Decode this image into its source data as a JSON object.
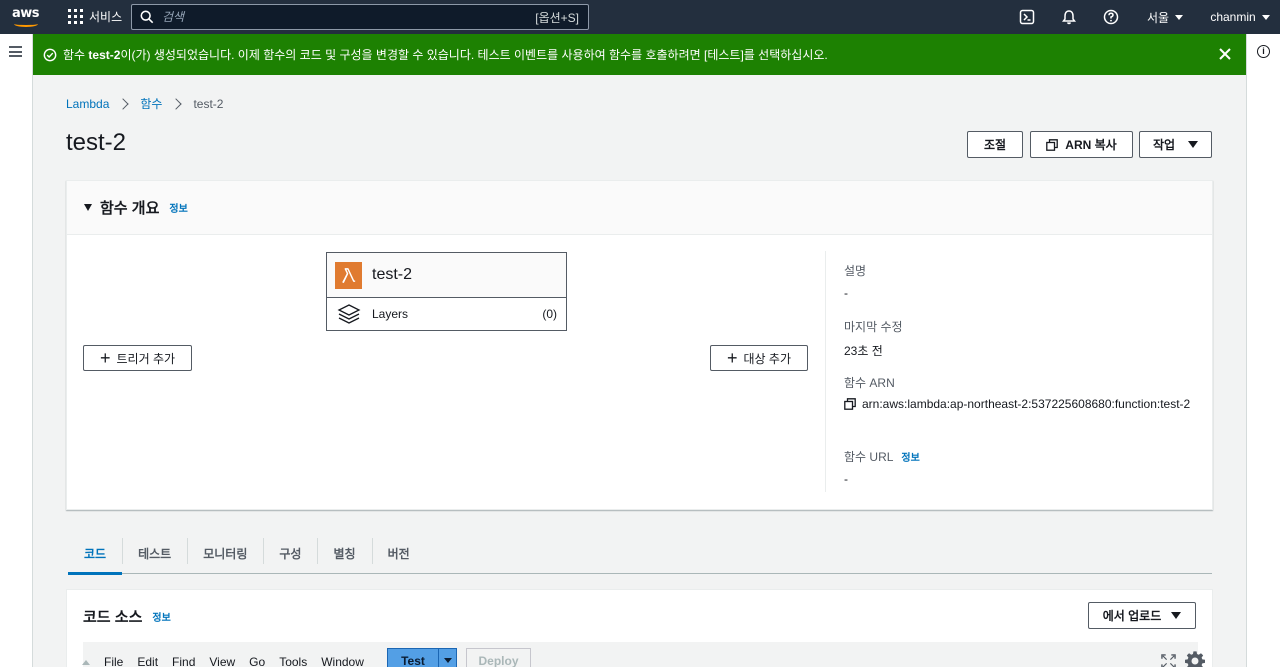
{
  "colors": {
    "nav_bg": "#232f3e",
    "flash_success": "#1d8102",
    "link": "#0073bb",
    "lambda_orange": "#e07b30",
    "primary_test": "#539fe5"
  },
  "topnav": {
    "logo_text": "aws",
    "services_label": "서비스",
    "search_placeholder": "검색",
    "search_shortcut": "[옵션+S]",
    "region_label": "서울",
    "user_label": "chanmin"
  },
  "flash": {
    "prefix": "함수 ",
    "function_name": "test-2",
    "message": "이(가) 생성되었습니다. 이제 함수의 코드 및 구성을 변경할 수 있습니다. 테스트 이벤트를 사용하여 함수를 호출하려면 [테스트]를 선택하십시오."
  },
  "breadcrumb": {
    "items": [
      "Lambda",
      "함수"
    ],
    "current": "test-2"
  },
  "header": {
    "title": "test-2",
    "throttle_label": "조절",
    "copy_arn_label": "ARN 복사",
    "actions_label": "작업"
  },
  "overview": {
    "title": "함수 개요",
    "info_label": "정보",
    "function_name": "test-2",
    "layers_label": "Layers",
    "layers_count": "(0)",
    "add_trigger_label": "트리거 추가",
    "add_destination_label": "대상 추가",
    "description_label": "설명",
    "description_value": "-",
    "last_modified_label": "마지막 수정",
    "last_modified_value": "23초 전",
    "arn_label": "함수 ARN",
    "arn_value": "arn:aws:lambda:ap-northeast-2:537225608680:function:test-2",
    "url_label": "함수 URL",
    "url_info_label": "정보",
    "url_value": "-"
  },
  "tabs": [
    {
      "label": "코드",
      "active": true
    },
    {
      "label": "테스트",
      "active": false
    },
    {
      "label": "모니터링",
      "active": false
    },
    {
      "label": "구성",
      "active": false
    },
    {
      "label": "별칭",
      "active": false
    },
    {
      "label": "버전",
      "active": false
    }
  ],
  "code_source": {
    "title": "코드 소스",
    "info_label": "정보",
    "upload_label": "에서 업로드",
    "menu": [
      "File",
      "Edit",
      "Find",
      "View",
      "Go",
      "Tools",
      "Window"
    ],
    "test_label": "Test",
    "deploy_label": "Deploy"
  }
}
